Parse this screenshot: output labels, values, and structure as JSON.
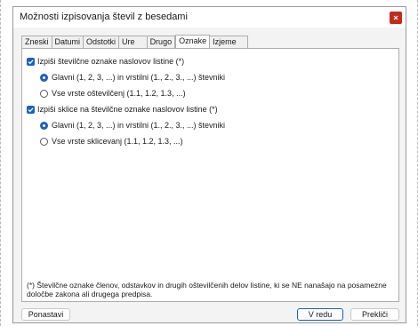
{
  "window": {
    "title": "Možnosti izpisovanja števil z besedami"
  },
  "tabs": [
    {
      "label": "Zneski",
      "active": false
    },
    {
      "label": "Datumi",
      "active": false
    },
    {
      "label": "Odstotki",
      "active": false
    },
    {
      "label": "Ure",
      "active": false
    },
    {
      "label": "Drugo",
      "active": false
    },
    {
      "label": "Oznake",
      "active": true
    },
    {
      "label": "Izjeme",
      "active": false
    }
  ],
  "options": {
    "group1": {
      "checkbox_label": "Izpiši številčne oznake naslovov listine (*)",
      "checked": true,
      "radio_main_label": "Glavni (1, 2, 3, ...) in vrstilni (1., 2., 3., ...) števniki",
      "radio_main_selected": true,
      "radio_all_label": "Vse vrste oštevilčenj (1.1, 1.2, 1.3, ...)",
      "radio_all_selected": false
    },
    "group2": {
      "checkbox_label": "Izpiši sklice na številčne oznake naslovov listine (*)",
      "checked": true,
      "radio_main_label": "Glavni (1, 2, 3, ...) in vrstilni (1., 2., 3., ...) števniki",
      "radio_main_selected": true,
      "radio_all_label": "Vse vrste sklicevanj (1.1, 1.2, 1.3, ...)",
      "radio_all_selected": false
    }
  },
  "footnote": "(*) Številčne oznake členov, odstavkov in drugih oštevilčenih delov listine, ki se NE nanašajo na posamezne določbe zakona ali drugega predpisa.",
  "buttons": {
    "reset_label": "Ponastavi",
    "ok_label": "V redu",
    "cancel_label": "Prekliči"
  },
  "colors": {
    "accent": "#1d5fc4",
    "close": "#c42b1c"
  }
}
